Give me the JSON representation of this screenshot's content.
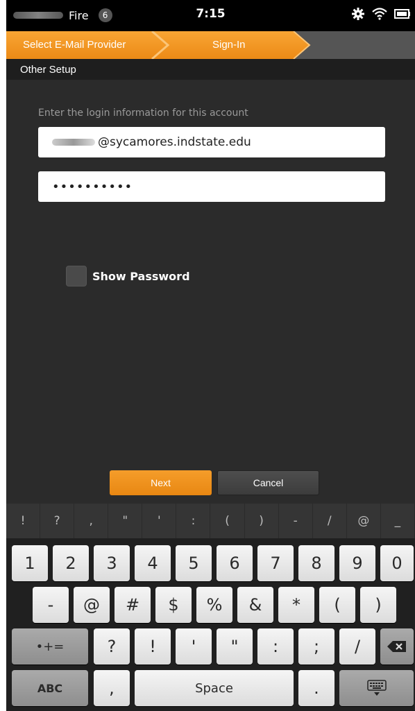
{
  "status_bar": {
    "device_label": "Fire",
    "notification_count": "6",
    "time": "7:15"
  },
  "breadcrumb": [
    {
      "label": "Select E-Mail Provider",
      "state": "done"
    },
    {
      "label": "Sign-In",
      "state": "current"
    }
  ],
  "header": {
    "title": "Other Setup"
  },
  "form": {
    "instruction": "Enter the login information for this account",
    "email_suffix": "@sycamores.indstate.edu",
    "password_mask": "••••••••••",
    "show_password_label": "Show Password",
    "show_password_checked": false
  },
  "buttons": {
    "next": "Next",
    "cancel": "Cancel"
  },
  "keyboard": {
    "symbol_bar": [
      "!",
      "?",
      ",",
      "\"",
      "'",
      ":",
      "(",
      ")",
      "-",
      "/",
      "@",
      "_"
    ],
    "row1": [
      "1",
      "2",
      "3",
      "4",
      "5",
      "6",
      "7",
      "8",
      "9",
      "0"
    ],
    "row2": [
      "-",
      "@",
      "#",
      "$",
      "%",
      "&",
      "*",
      "(",
      ")"
    ],
    "row3_mode": "•+=",
    "row3": [
      "?",
      "!",
      "'",
      "\"",
      ":",
      ";",
      "/"
    ],
    "abc_label": "ABC",
    "comma": ",",
    "space_label": "Space",
    "period": "."
  },
  "colors": {
    "accent": "#f39a22",
    "background": "#2b2b2b"
  }
}
